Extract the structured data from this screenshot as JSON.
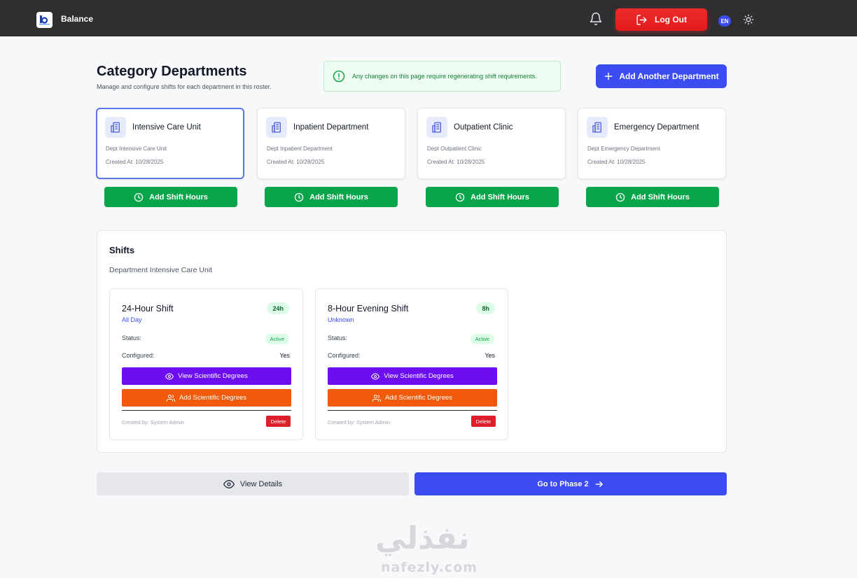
{
  "app": {
    "title": "Balance",
    "logout_label": "Log Out",
    "language": "EN"
  },
  "header": {
    "title": "Category Departments",
    "subtitle": "Manage and configure shifts for each department in this roster.",
    "notice": "Any changes on this page require regenerating shift requirements.",
    "add_department_label": "Add Another Department"
  },
  "departments": [
    {
      "name": "Intensive Care Unit",
      "desc": "Dept Intensive Care Unit",
      "created": "Created At: 10/28/2025",
      "selected": true
    },
    {
      "name": "Inpatient Department",
      "desc": "Dept Inpatient Department",
      "created": "Created At: 10/28/2025",
      "selected": false
    },
    {
      "name": "Outpatient Clinic",
      "desc": "Dept Outpatient Clinic",
      "created": "Created At: 10/28/2025",
      "selected": false
    },
    {
      "name": "Emergency Department",
      "desc": "Dept Emergency Department",
      "created": "Created At: 10/28/2025",
      "selected": false
    }
  ],
  "add_shift_hours_label": "Add Shift Hours",
  "shifts_panel": {
    "title": "Shifts",
    "department_label": "Department Intensive Care Unit",
    "status_label": "Status:",
    "configured_label": "Configured:",
    "view_degrees_label": "View Scientific Degrees",
    "add_degrees_label": "Add Scientific Degrees",
    "delete_label": "Delete",
    "shifts": [
      {
        "name": "24-Hour Shift",
        "sub": "All Day",
        "hours": "24h",
        "status": "Active",
        "configured": "Yes",
        "created_by": "Created by: System Admin"
      },
      {
        "name": "8-Hour Evening Shift",
        "sub": "Unknown",
        "hours": "8h",
        "status": "Active",
        "configured": "Yes",
        "created_by": "Created by: System Admin"
      }
    ]
  },
  "footer": {
    "view_details_label": "View Details",
    "phase2_label": "Go to Phase 2"
  },
  "watermark": {
    "arabic": "نفذلي",
    "latin": "nafezly.com"
  },
  "colors": {
    "topbar": "#2f2f31",
    "primary": "#3b4cf0",
    "success": "#0aa54a",
    "danger": "#dc1f2a",
    "purple": "#6d0ef0",
    "orange": "#f05a0a"
  },
  "icons": {
    "bell": "bell-icon",
    "logout": "logout-icon",
    "theme": "sun-icon",
    "notice": "alert-circle-icon",
    "plus": "plus-icon",
    "department": "building-icon",
    "clock": "clock-icon",
    "eye": "eye-icon",
    "users": "users-icon",
    "arrow": "arrow-right-icon"
  }
}
